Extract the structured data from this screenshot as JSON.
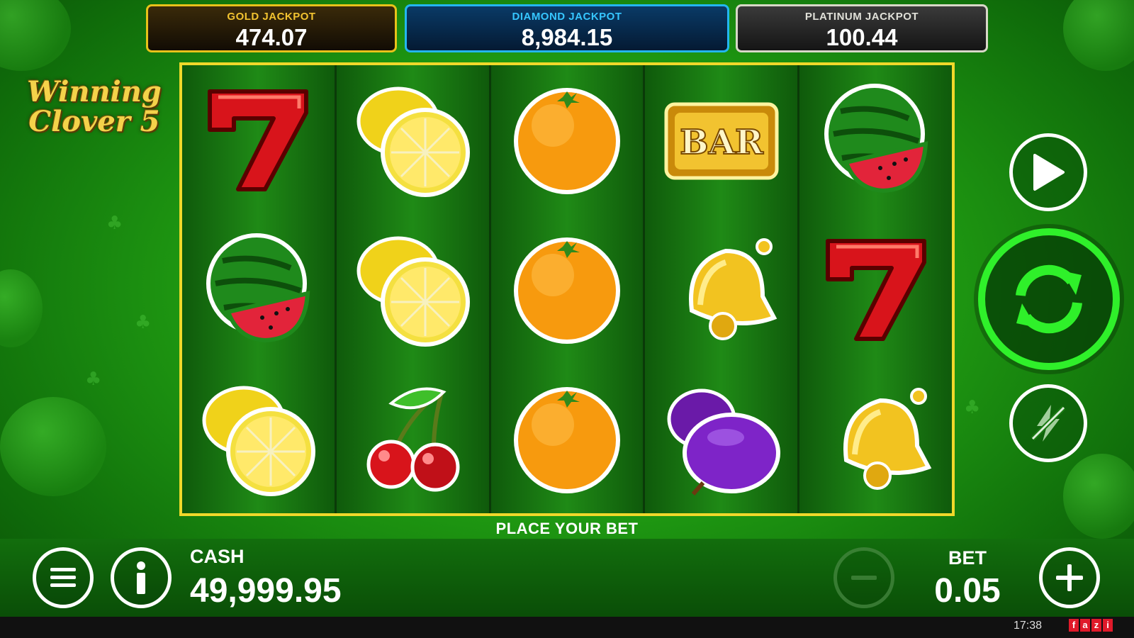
{
  "jackpots": [
    {
      "label": "GOLD JACKPOT",
      "value": "474.07"
    },
    {
      "label": "DIAMOND JACKPOT",
      "value": "8,984.15"
    },
    {
      "label": "PLATINUM JACKPOT",
      "value": "100.44"
    }
  ],
  "logo": {
    "line1": "Winning",
    "line2": "Clover 5"
  },
  "reels": [
    [
      "seven",
      "watermelon",
      "lemon"
    ],
    [
      "lemon",
      "lemon",
      "cherry"
    ],
    [
      "orange",
      "orange",
      "orange"
    ],
    [
      "bar",
      "bell",
      "plum"
    ],
    [
      "watermelon",
      "seven",
      "bell"
    ]
  ],
  "bar_symbol_text": "BAR",
  "status_text": "PLACE YOUR BET",
  "controls": {
    "play_icon": "play-icon",
    "spin_icon": "spin-arrows-icon",
    "turbo_icon": "turbo-off-icon",
    "menu_icon": "menu-icon",
    "info_icon": "info-icon",
    "decrease_icon": "minus-icon",
    "increase_icon": "plus-icon"
  },
  "cash": {
    "label": "CASH",
    "value": "49,999.95"
  },
  "bet": {
    "label": "BET",
    "value": "0.05"
  },
  "system": {
    "time": "17:38",
    "brand": "fazi"
  },
  "colors": {
    "gold": "#f2c330",
    "diamond": "#36c6ff",
    "platinum": "#e0e0d8",
    "spin_ring": "#2ff02a",
    "reel_border": "#f0d82a"
  }
}
